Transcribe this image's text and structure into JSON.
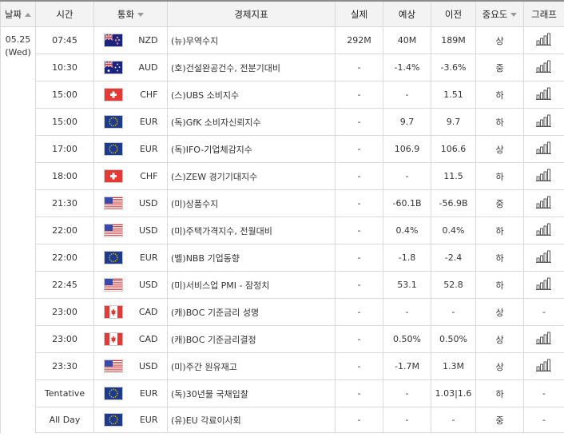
{
  "headers": {
    "date": "날짜",
    "time": "시간",
    "currency": "통화",
    "event": "경제지표",
    "actual": "실제",
    "forecast": "예상",
    "previous": "이전",
    "importance": "중요도",
    "graph": "그래프"
  },
  "date": {
    "day": "05.25",
    "weekday": "(Wed)"
  },
  "rows": [
    {
      "time": "07:45",
      "flag": "nz",
      "cur": "NZD",
      "event": "(뉴)무역수지",
      "actual": "292M",
      "forecast": "40M",
      "previous": "189M",
      "imp": "상",
      "graph": true
    },
    {
      "time": "10:30",
      "flag": "au",
      "cur": "AUD",
      "event": "(호)건설완공건수, 전분기대비",
      "actual": "-",
      "forecast": "-1.4%",
      "previous": "-3.6%",
      "imp": "중",
      "graph": true
    },
    {
      "time": "15:00",
      "flag": "ch",
      "cur": "CHF",
      "event": "(스)UBS 소비지수",
      "actual": "-",
      "forecast": "-",
      "previous": "1.51",
      "imp": "하",
      "graph": true
    },
    {
      "time": "15:00",
      "flag": "eu",
      "cur": "EUR",
      "event": "(독)GfK 소비자신뢰지수",
      "actual": "-",
      "forecast": "9.7",
      "previous": "9.7",
      "imp": "하",
      "graph": true
    },
    {
      "time": "17:00",
      "flag": "eu",
      "cur": "EUR",
      "event": "(독)IFO-기업체감지수",
      "actual": "-",
      "forecast": "106.9",
      "previous": "106.6",
      "imp": "상",
      "graph": true
    },
    {
      "time": "18:00",
      "flag": "ch",
      "cur": "CHF",
      "event": "(스)ZEW 경기기대지수",
      "actual": "-",
      "forecast": "-",
      "previous": "11.5",
      "imp": "하",
      "graph": true
    },
    {
      "time": "21:30",
      "flag": "us",
      "cur": "USD",
      "event": "(미)상품수지",
      "actual": "-",
      "forecast": "-60.1B",
      "previous": "-56.9B",
      "imp": "중",
      "graph": true
    },
    {
      "time": "22:00",
      "flag": "us",
      "cur": "USD",
      "event": "(미)주택가격지수, 전월대비",
      "actual": "-",
      "forecast": "0.4%",
      "previous": "0.4%",
      "imp": "하",
      "graph": true
    },
    {
      "time": "22:00",
      "flag": "eu",
      "cur": "EUR",
      "event": "(벨)NBB 기업동향",
      "actual": "-",
      "forecast": "-1.8",
      "previous": "-2.4",
      "imp": "하",
      "graph": true
    },
    {
      "time": "22:45",
      "flag": "us",
      "cur": "USD",
      "event": "(미)서비스업 PMI - 잠정치",
      "actual": "-",
      "forecast": "53.1",
      "previous": "52.8",
      "imp": "하",
      "graph": true
    },
    {
      "time": "23:00",
      "flag": "ca",
      "cur": "CAD",
      "event": "(캐)BOC 기준금리 성명",
      "actual": "-",
      "forecast": "-",
      "previous": "-",
      "imp": "상",
      "graph": false,
      "graph_text": "-"
    },
    {
      "time": "23:00",
      "flag": "ca",
      "cur": "CAD",
      "event": "(캐)BOC 기준금리결정",
      "actual": "-",
      "forecast": "0.50%",
      "previous": "0.50%",
      "imp": "상",
      "graph": true
    },
    {
      "time": "23:30",
      "flag": "us",
      "cur": "USD",
      "event": "(미)주간 원유재고",
      "actual": "-",
      "forecast": "-1.7M",
      "previous": "1.3M",
      "imp": "상",
      "graph": true
    },
    {
      "time": "Tentative",
      "flag": "eu",
      "cur": "EUR",
      "event": "(독)30년물 국채입찰",
      "actual": "-",
      "forecast": "-",
      "previous": "1.03|1.6",
      "imp": "하",
      "graph": false,
      "graph_text": "-"
    },
    {
      "time": "All Day",
      "flag": "eu",
      "cur": "EUR",
      "event": "(유)EU 각료이사회",
      "actual": "-",
      "forecast": "-",
      "previous": "-",
      "imp": "중",
      "graph": false,
      "graph_text": "-"
    }
  ],
  "colors": {
    "header_bg": "#f3f3f3",
    "border": "#d9d9d9",
    "bars": "#555555"
  }
}
